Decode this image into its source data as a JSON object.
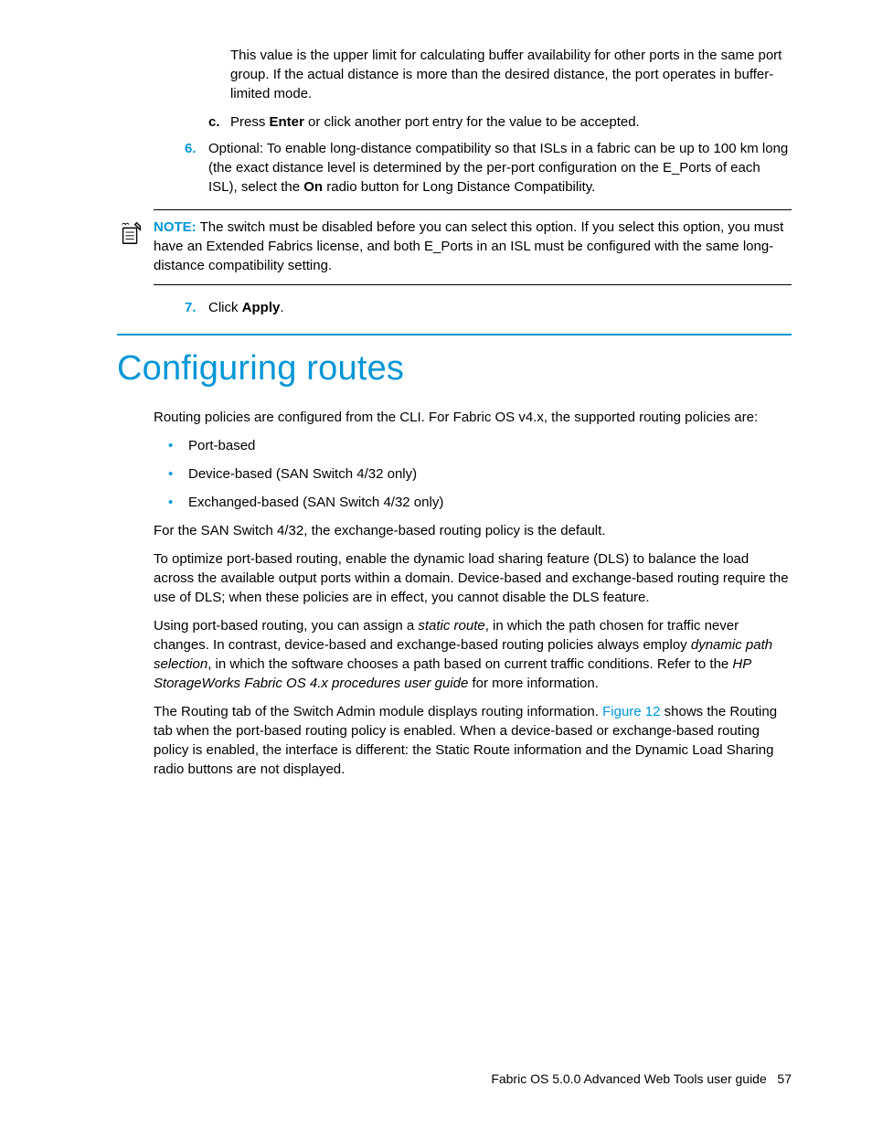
{
  "top": {
    "para1": "This value is the upper limit for calculating buffer availability for other ports in the same port group. If the actual distance is more than the desired distance, the port operates in buffer-limited mode.",
    "step_c_marker": "c.",
    "step_c_pre": "Press ",
    "step_c_bold": "Enter",
    "step_c_post": " or click another port entry for the value to be accepted.",
    "step6_marker": "6.",
    "step6_pre": "Optional: To enable long-distance compatibility so that ISLs in a fabric can be up to 100 km long (the exact distance level is determined by the per-port configuration on the E_Ports of each ISL), select the ",
    "step6_bold": "On",
    "step6_post": " radio button for Long Distance Compatibility.",
    "note_label": "NOTE:",
    "note_text": " The switch must be disabled before you can select this option. If you select this option, you must have an Extended Fabrics license, and both E_Ports in an ISL must be configured with the same long-distance compatibility setting.",
    "step7_marker": "7.",
    "step7_pre": "Click ",
    "step7_bold": "Apply",
    "step7_post": "."
  },
  "section": {
    "heading": "Configuring routes",
    "intro": "Routing policies are configured from the CLI. For Fabric OS v4.x, the supported routing policies are:",
    "bullets": [
      "Port-based",
      "Device-based (SAN Switch 4/32 only)",
      "Exchanged-based (SAN Switch 4/32 only)"
    ],
    "p1": "For the SAN Switch 4/32, the exchange-based routing policy is the default.",
    "p2": "To optimize port-based routing, enable the dynamic load sharing feature (DLS) to balance the load across the available output ports within a domain. Device-based and exchange-based routing require the use of DLS; when these policies are in effect, you cannot disable the DLS feature.",
    "p3_a": "Using port-based routing, you can assign a ",
    "p3_i1": "static route",
    "p3_b": ", in which the path chosen for traffic never changes. In contrast, device-based and exchange-based routing policies always employ ",
    "p3_i2": "dynamic path selection",
    "p3_c": ", in which the software chooses a path based on current traffic conditions. Refer to the ",
    "p3_i3": "HP StorageWorks Fabric OS 4.x procedures user guide",
    "p3_d": " for more information.",
    "p4_a": "The Routing tab of the Switch Admin module displays routing information. ",
    "p4_link": "Figure 12",
    "p4_b": " shows the Routing tab when the port-based routing policy is enabled. When a device-based or exchange-based routing policy is enabled, the interface is different: the Static Route information and the Dynamic Load Sharing radio buttons are not displayed."
  },
  "footer": {
    "title": "Fabric OS 5.0.0 Advanced Web Tools user guide",
    "page": "57"
  }
}
